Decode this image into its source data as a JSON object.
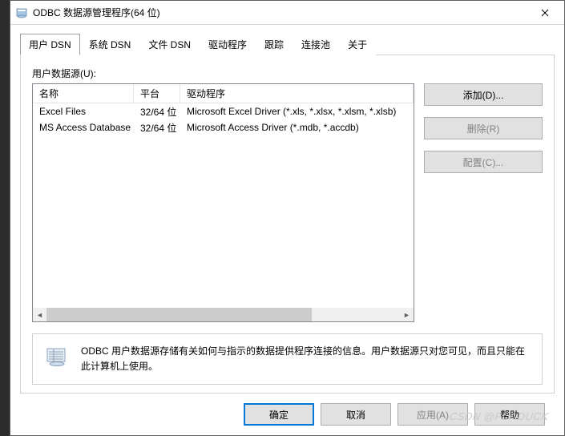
{
  "window": {
    "title": "ODBC 数据源管理程序(64 位)"
  },
  "tabs": [
    {
      "label": "用户 DSN"
    },
    {
      "label": "系统 DSN"
    },
    {
      "label": "文件 DSN"
    },
    {
      "label": "驱动程序"
    },
    {
      "label": "跟踪"
    },
    {
      "label": "连接池"
    },
    {
      "label": "关于"
    }
  ],
  "panel": {
    "list_label": "用户数据源(U):",
    "columns": {
      "name": "名称",
      "platform": "平台",
      "driver": "驱动程序"
    },
    "rows": [
      {
        "name": "Excel Files",
        "platform": "32/64 位",
        "driver": "Microsoft Excel Driver (*.xls, *.xlsx, *.xlsm, *.xlsb)"
      },
      {
        "name": "MS Access Database",
        "platform": "32/64 位",
        "driver": "Microsoft Access Driver (*.mdb, *.accdb)"
      }
    ],
    "buttons": {
      "add": "添加(D)...",
      "remove": "删除(R)",
      "configure": "配置(C)..."
    },
    "info": "ODBC 用户数据源存储有关如何与指示的数据提供程序连接的信息。用户数据源只对您可见，而且只能在此计算机上使用。"
  },
  "footer": {
    "ok": "确定",
    "cancel": "取消",
    "apply": "应用(A)",
    "help": "帮助"
  },
  "watermark": "CSDN @FLY-DUCK"
}
